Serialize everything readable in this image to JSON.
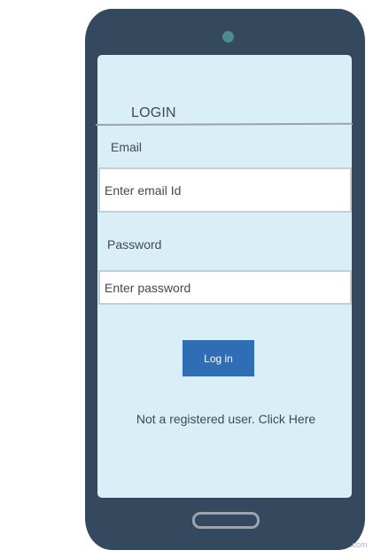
{
  "screen": {
    "title": "LOGIN",
    "email": {
      "label": "Email",
      "placeholder": "Enter email Id",
      "value": ""
    },
    "password": {
      "label": "Password",
      "placeholder": "Enter password",
      "value": ""
    },
    "login_button_label": "Log in",
    "register_link_text": "Not a registered user. Click Here"
  },
  "watermark": ".com",
  "colors": {
    "phone_body": "#34495e",
    "screen_background": "#daeef8",
    "button_primary": "#2f6db5",
    "camera": "#4f8b93"
  }
}
